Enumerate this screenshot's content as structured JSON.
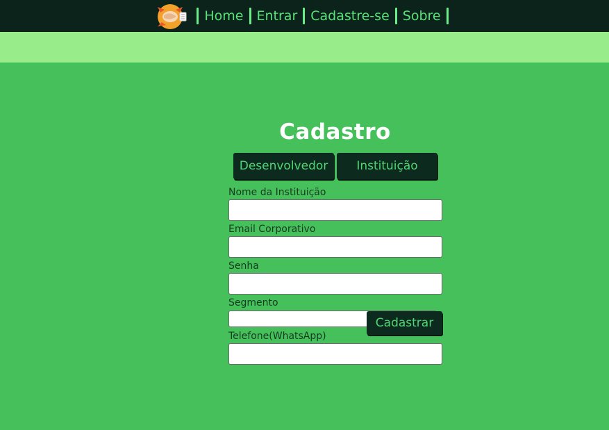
{
  "nav": {
    "home": "Home",
    "entrar": "Entrar",
    "cadastre": "Cadastre-se",
    "sobre": "Sobre"
  },
  "page": {
    "title": "Cadastro"
  },
  "tabs": {
    "developer": "Desenvolvedor",
    "institution": "Instituição"
  },
  "form": {
    "institution_name_label": "Nome da Instituição",
    "institution_name_value": "",
    "email_label": "Email Corporativo",
    "email_value": "",
    "password_label": "Senha",
    "password_value": "",
    "segment_label": "Segmento",
    "segment_selected": "",
    "phone_label": "Telefone(WhatsApp)",
    "phone_value": "",
    "submit_label": "Cadastrar"
  },
  "colors": {
    "topbar": "#0b231b",
    "subbar": "#98ec8a",
    "background": "#45c05a",
    "button_bg": "#0c2a1e",
    "button_text": "#4fd672",
    "nav_text": "#58e379"
  },
  "icons": {
    "logo": "handshake-logo-icon",
    "select": "chevron-down-icon"
  }
}
